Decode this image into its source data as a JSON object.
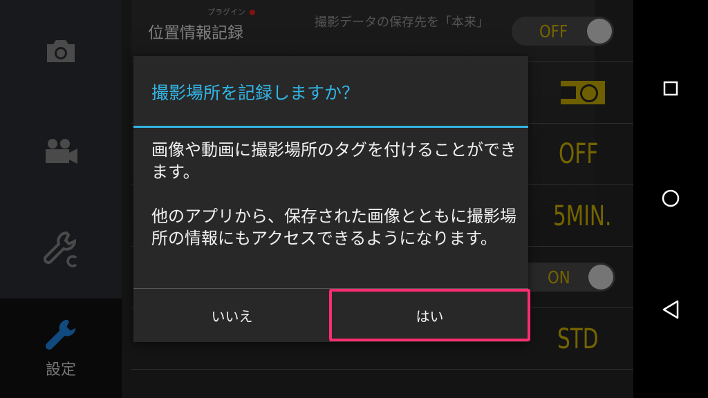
{
  "sidebar": {
    "items": [
      {
        "icon": "camera-icon"
      },
      {
        "icon": "video-camera-icon"
      },
      {
        "icon": "wrench-c-icon"
      },
      {
        "icon": "wrench-icon",
        "label": "設定"
      }
    ]
  },
  "settings": {
    "row1_title": "位置情報記録",
    "row1_value": "OFF",
    "ghost_text": "撮影データの保存先を「本来」",
    "ghost_badge": "プラグイン",
    "row3_value": "OFF",
    "row4_value": "5MIN.",
    "row5_value": "ON",
    "row6_value": "STD",
    "accent_color": "#d4b700"
  },
  "dialog": {
    "title": "撮影場所を記録しますか？",
    "body": "画像や動画に撮影場所のタグを付けることができます。\n\n他のアプリから、保存された画像とともに撮影場所の情報にもアクセスできるようになります。",
    "no_label": "いいえ",
    "yes_label": "はい",
    "title_color": "#33b5e5",
    "highlight_color": "#ff2d6f"
  },
  "navbar": {
    "items": [
      "recents-icon",
      "home-icon",
      "back-icon"
    ]
  }
}
